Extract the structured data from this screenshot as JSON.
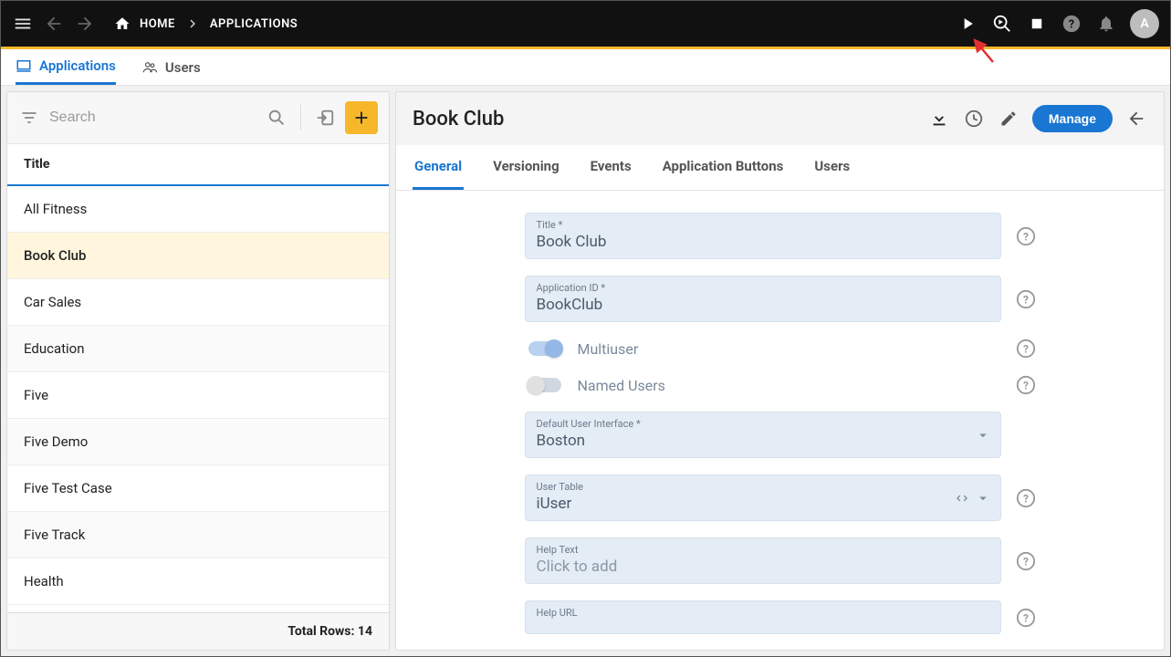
{
  "topbar": {
    "breadcrumb": {
      "home": "HOME",
      "current": "APPLICATIONS"
    },
    "avatar_initial": "A"
  },
  "main_tabs": {
    "applications": "Applications",
    "users": "Users"
  },
  "search": {
    "placeholder": "Search"
  },
  "left": {
    "header": "Title",
    "items": [
      {
        "title": "All Fitness"
      },
      {
        "title": "Book Club"
      },
      {
        "title": "Car Sales"
      },
      {
        "title": "Education"
      },
      {
        "title": "Five"
      },
      {
        "title": "Five Demo"
      },
      {
        "title": "Five Test Case"
      },
      {
        "title": "Five Track"
      },
      {
        "title": "Health"
      }
    ],
    "selected_index": 1,
    "totals_label": "Total Rows: 14"
  },
  "detail": {
    "title": "Book Club",
    "manage_label": "Manage",
    "tabs": [
      "General",
      "Versioning",
      "Events",
      "Application Buttons",
      "Users"
    ],
    "active_tab": 0,
    "fields": {
      "title": {
        "label": "Title *",
        "value": "Book Club"
      },
      "app_id": {
        "label": "Application ID *",
        "value": "BookClub"
      },
      "multiuser": {
        "label": "Multiuser",
        "on": true
      },
      "named_users": {
        "label": "Named Users",
        "on": false
      },
      "ui": {
        "label": "Default User Interface *",
        "value": "Boston"
      },
      "user_table": {
        "label": "User Table",
        "value": "iUser"
      },
      "help_text": {
        "label": "Help Text",
        "placeholder": "Click to add"
      },
      "help_url": {
        "label": "Help URL"
      }
    }
  }
}
